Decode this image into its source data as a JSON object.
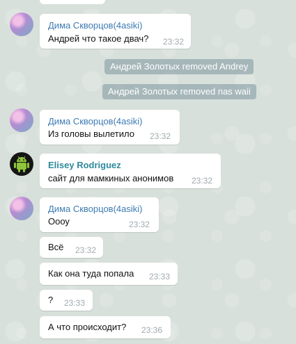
{
  "messages": [
    {
      "sender": "Дима Скворцов(4asiki)",
      "text": "Андрей что такое двач?",
      "time": "23:32"
    },
    {
      "service": "Андрей Золотых removed Andrey"
    },
    {
      "service": "Андрей Золотых removed nas waii"
    },
    {
      "sender": "Дима Скворцов(4asiki)",
      "text": "Из головы вылетило",
      "time": "23:32"
    },
    {
      "sender": "Elisey Rodriguez",
      "text": "сайт для мамкиных анонимов",
      "time": "23:32"
    },
    {
      "sender": "Дима Скворцов(4asiki)",
      "text": "Оооу",
      "time": "23:32"
    },
    {
      "text": "Всё",
      "time": "23:32"
    },
    {
      "text": "Как она туда попала",
      "time": "23:33"
    },
    {
      "text": "?",
      "time": "23:33"
    },
    {
      "text": "А что происходит?",
      "time": "23:36"
    }
  ],
  "icons": {
    "avatar_dima": "gradient-avatar",
    "avatar_elisey": "android-icon"
  },
  "colors": {
    "sender_blue": "#3c7bb3",
    "sender_teal": "#2d8a9c",
    "service_bg": "#96aaaf"
  }
}
